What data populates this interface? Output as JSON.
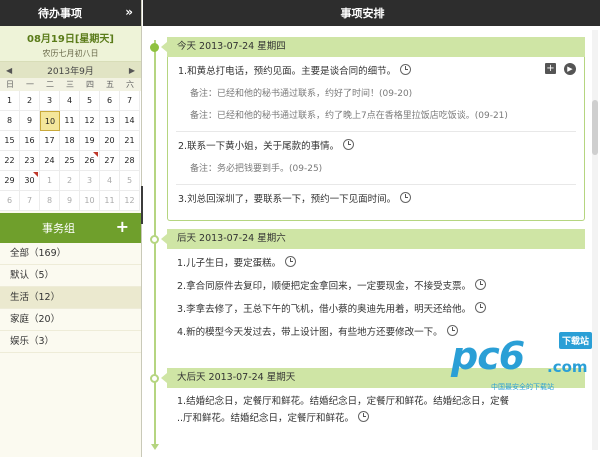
{
  "left_panel": {
    "title": "待办事项",
    "collapse_glyph": "»",
    "date_line": "08月19日[星期天]",
    "lunar_line": "农历七月初八日",
    "calendar": {
      "prev_glyph": "◀",
      "next_glyph": "▶",
      "month_label": "2013年9月",
      "weekdays": [
        "日",
        "一",
        "二",
        "三",
        "四",
        "五",
        "六"
      ],
      "weeks": [
        [
          "1",
          "2",
          "3",
          "4",
          "5",
          "6",
          "7"
        ],
        [
          "8",
          "9",
          "10",
          "11",
          "12",
          "13",
          "14"
        ],
        [
          "15",
          "16",
          "17",
          "18",
          "19",
          "20",
          "21"
        ],
        [
          "22",
          "23",
          "24",
          "25",
          "26",
          "27",
          "28"
        ],
        [
          "29",
          "30",
          "1",
          "2",
          "3",
          "4",
          "5"
        ],
        [
          "6",
          "7",
          "8",
          "9",
          "10",
          "11",
          "12"
        ]
      ]
    },
    "groups_title": "事务组",
    "groups_add_glyph": "+",
    "groups": [
      {
        "label": "全部（169）"
      },
      {
        "label": "默认（5）"
      },
      {
        "label": "生活（12）"
      },
      {
        "label": "家庭（20）"
      },
      {
        "label": "娱乐（3）"
      }
    ]
  },
  "main": {
    "title": "事项安排",
    "sections": [
      {
        "header": "今天  2013-07-24  星期四",
        "items": [
          {
            "text": "1.和黄总打电话，预约见面。主要是谈合同的细节。",
            "notes": [
              "备注：已经和他的秘书通过联系，约好了时间！(09-20)",
              "备注：已经和他的秘书通过联系，约了晚上7点在香格里拉饭店吃饭谈。(09-21)"
            ]
          },
          {
            "text": "2.联系一下黄小姐，关于尾款的事情。",
            "notes": [
              "备注：务必把钱要到手。(09-25)"
            ]
          },
          {
            "text": "3.刘总回深圳了，要联系一下，预约一下见面时间。",
            "notes": []
          }
        ],
        "actions": {
          "add_glyph": "+",
          "go_glyph": "▶"
        }
      },
      {
        "header": "后天  2013-07-24  星期六",
        "items": [
          {
            "text": "1.儿子生日，要定蛋糕。"
          },
          {
            "text": "2.拿合同原件去复印，顺便把定金拿回来，一定要现金，不接受支票。"
          },
          {
            "text": "3.李拿去修了，王总下午的飞机，借小蔡的奥迪先用着，明天还给他。"
          },
          {
            "text": "4.新的模型今天发过去，带上设计图，有些地方还要修改一下。"
          }
        ]
      },
      {
        "header": "大后天  2013-07-24  星期天",
        "items": [
          {
            "text": "1.结婚纪念日，定餐厅和鲜花。结婚纪念日，定餐厅和鲜花。结婚纪念日，定餐"
          },
          {
            "text": "..厅和鲜花。结婚纪念日，定餐厅和鲜花。"
          }
        ]
      }
    ]
  },
  "watermark": {
    "logo_prefix": "pc",
    "logo_digit": "6",
    "domain": ".com",
    "badge": "下载站",
    "tagline": "中国最安全的下载站"
  },
  "colors": {
    "accent": "#8fc23f",
    "dark_header": "#2d2d2d",
    "group_bar": "#6f9f2c",
    "section_head": "#cfe5a5"
  }
}
